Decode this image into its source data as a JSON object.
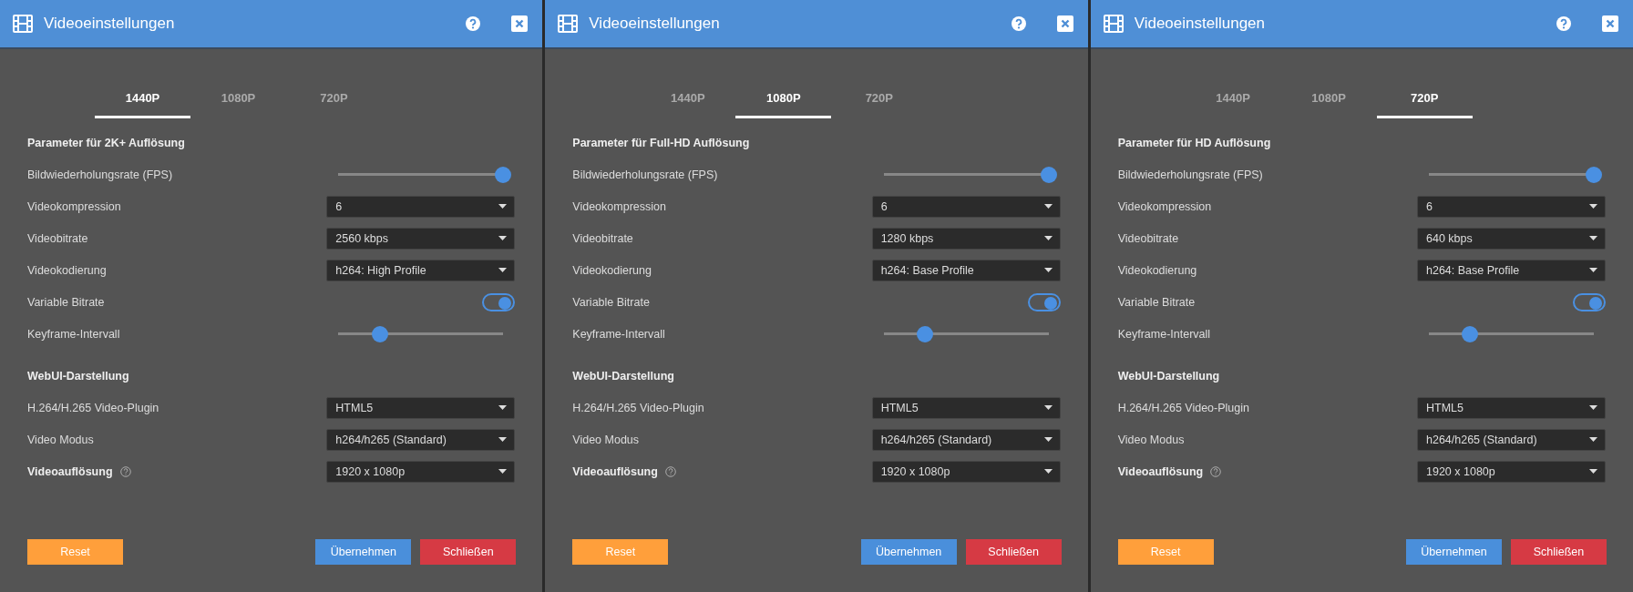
{
  "panels": [
    {
      "title": "Videoeinstellungen",
      "tabs": [
        {
          "label": "1440P",
          "selected": true
        },
        {
          "label": "1080P",
          "selected": false
        },
        {
          "label": "720P",
          "selected": false
        }
      ],
      "sections": [
        {
          "title": "Parameter für 2K+ Auflösung",
          "rows": [
            {
              "kind": "slider",
              "label": "Bildwiederholungsrate (FPS)",
              "level": 1.0
            },
            {
              "kind": "select",
              "label": "Videokompression",
              "value": "6"
            },
            {
              "kind": "select",
              "label": "Videobitrate",
              "value": "2560 kbps"
            },
            {
              "kind": "select",
              "label": "Videokodierung",
              "value": "h264: High Profile"
            },
            {
              "kind": "toggle",
              "label": "Variable Bitrate",
              "on": true
            },
            {
              "kind": "slider",
              "label": "Keyframe-Intervall",
              "level": 0.25
            }
          ]
        },
        {
          "title": "WebUI-Darstellung",
          "rows": [
            {
              "kind": "select",
              "label": "H.264/H.265 Video-Plugin",
              "value": "HTML5"
            },
            {
              "kind": "select",
              "label": "Video Modus",
              "value": "h264/h265 (Standard)"
            },
            {
              "kind": "select",
              "label": "Videoauflösung",
              "value": "1920 x 1080p",
              "emphasized": true,
              "help": true
            }
          ]
        }
      ],
      "buttons": {
        "reset": "Reset",
        "apply": "Übernehmen",
        "close": "Schließen"
      }
    },
    {
      "title": "Videoeinstellungen",
      "tabs": [
        {
          "label": "1440P",
          "selected": false
        },
        {
          "label": "1080P",
          "selected": true
        },
        {
          "label": "720P",
          "selected": false
        }
      ],
      "sections": [
        {
          "title": "Parameter für Full-HD Auflösung",
          "rows": [
            {
              "kind": "slider",
              "label": "Bildwiederholungsrate (FPS)",
              "level": 1.0
            },
            {
              "kind": "select",
              "label": "Videokompression",
              "value": "6"
            },
            {
              "kind": "select",
              "label": "Videobitrate",
              "value": "1280 kbps"
            },
            {
              "kind": "select",
              "label": "Videokodierung",
              "value": "h264: Base Profile"
            },
            {
              "kind": "toggle",
              "label": "Variable Bitrate",
              "on": true
            },
            {
              "kind": "slider",
              "label": "Keyframe-Intervall",
              "level": 0.25
            }
          ]
        },
        {
          "title": "WebUI-Darstellung",
          "rows": [
            {
              "kind": "select",
              "label": "H.264/H.265 Video-Plugin",
              "value": "HTML5"
            },
            {
              "kind": "select",
              "label": "Video Modus",
              "value": "h264/h265 (Standard)"
            },
            {
              "kind": "select",
              "label": "Videoauflösung",
              "value": "1920 x 1080p",
              "emphasized": true,
              "help": true
            }
          ]
        }
      ],
      "buttons": {
        "reset": "Reset",
        "apply": "Übernehmen",
        "close": "Schließen"
      }
    },
    {
      "title": "Videoeinstellungen",
      "tabs": [
        {
          "label": "1440P",
          "selected": false
        },
        {
          "label": "1080P",
          "selected": false
        },
        {
          "label": "720P",
          "selected": true
        }
      ],
      "sections": [
        {
          "title": "Parameter für HD Auflösung",
          "rows": [
            {
              "kind": "slider",
              "label": "Bildwiederholungsrate (FPS)",
              "level": 1.0
            },
            {
              "kind": "select",
              "label": "Videokompression",
              "value": "6"
            },
            {
              "kind": "select",
              "label": "Videobitrate",
              "value": "640 kbps"
            },
            {
              "kind": "select",
              "label": "Videokodierung",
              "value": "h264: Base Profile"
            },
            {
              "kind": "toggle",
              "label": "Variable Bitrate",
              "on": true
            },
            {
              "kind": "slider",
              "label": "Keyframe-Intervall",
              "level": 0.25
            }
          ]
        },
        {
          "title": "WebUI-Darstellung",
          "rows": [
            {
              "kind": "select",
              "label": "H.264/H.265 Video-Plugin",
              "value": "HTML5"
            },
            {
              "kind": "select",
              "label": "Video Modus",
              "value": "h264/h265 (Standard)"
            },
            {
              "kind": "select",
              "label": "Videoauflösung",
              "value": "1920 x 1080p",
              "emphasized": true,
              "help": true
            }
          ]
        }
      ],
      "buttons": {
        "reset": "Reset",
        "apply": "Übernehmen",
        "close": "Schließen"
      }
    }
  ]
}
